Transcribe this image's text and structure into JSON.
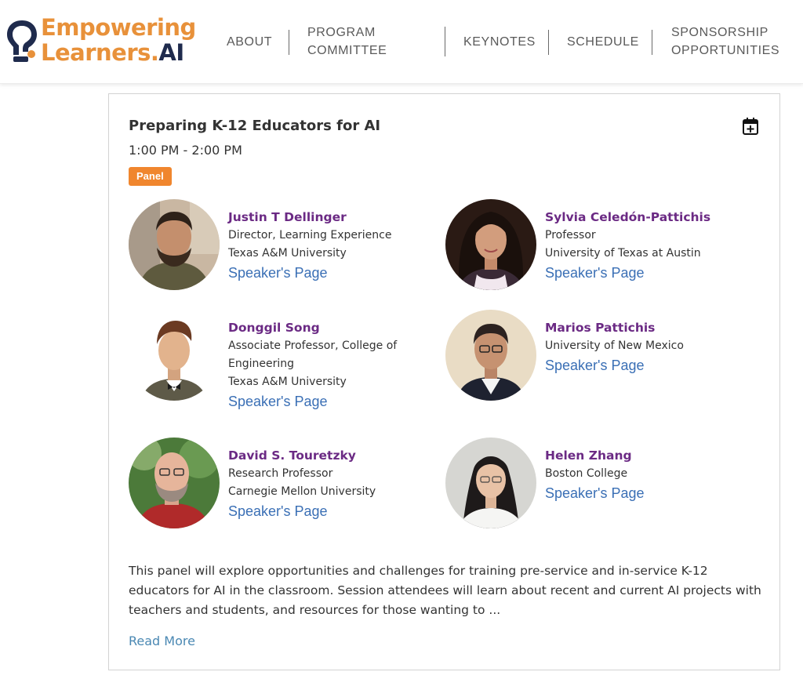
{
  "brand": {
    "line1": "Empowering",
    "line2_main": "Learners.",
    "line2_accent": "AI",
    "colors": {
      "orange": "#e8913a",
      "navy": "#1f2b4d"
    }
  },
  "nav": {
    "about": "ABOUT",
    "program_line1": "PROGRAM",
    "program_line2": "COMMITTEE",
    "keynotes": "KEYNOTES",
    "schedule": "SCHEDULE",
    "sponsorship_line1": "SPONSORSHIP",
    "sponsorship_line2": "OPPORTUNITIES"
  },
  "session": {
    "title": "Preparing K-12 Educators for AI",
    "time": "1:00 PM - 2:00 PM",
    "tag": "Panel",
    "tag_color": "#f0862e",
    "calendar_icon": "calendar-add-icon"
  },
  "speakers": [
    {
      "name": "Justin T Dellinger",
      "line1": "Director, Learning Experience",
      "line2": "Texas A&M University",
      "line3": "",
      "link": "Speaker's Page"
    },
    {
      "name": "Sylvia Celedón-Pattichis",
      "line1": "Professor",
      "line2": "University of Texas at Austin",
      "line3": "",
      "link": "Speaker's Page"
    },
    {
      "name": "Donggil Song",
      "line1": "Associate Professor, College of",
      "line2": "Engineering",
      "line3": "Texas A&M University",
      "link": "Speaker's Page"
    },
    {
      "name": "Marios Pattichis",
      "line1": "University of New Mexico",
      "line2": "",
      "line3": "",
      "link": "Speaker's Page"
    },
    {
      "name": "David S. Touretzky",
      "line1": "Research Professor",
      "line2": "Carnegie Mellon University",
      "line3": "",
      "link": "Speaker's Page"
    },
    {
      "name": "Helen Zhang",
      "line1": "Boston College",
      "line2": "",
      "line3": "",
      "link": "Speaker's Page"
    }
  ],
  "description": "This panel will explore opportunities and challenges for training pre-service and in-service K-12 educators for AI in the classroom. Session attendees will learn about recent and current AI projects with teachers and students, and resources for those wanting to ...",
  "read_more": "Read More",
  "colors": {
    "speaker_name": "#6b2a84",
    "link": "#3a6fb5",
    "read_more": "#4a88b3"
  }
}
